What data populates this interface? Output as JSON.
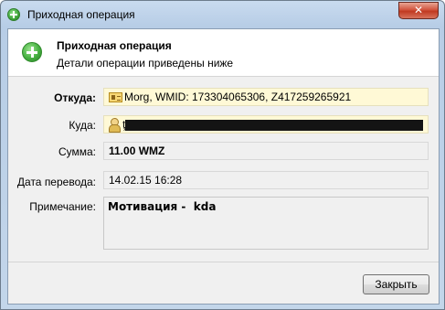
{
  "window": {
    "title": "Приходная операция",
    "close_glyph": "✕"
  },
  "header": {
    "title": "Приходная операция",
    "subtitle": "Детали операции приведены ниже"
  },
  "form": {
    "from_label": "Откуда:",
    "from_value": "Morg, WMID: 173304065306, Z417259265921",
    "to_label": "Куда:",
    "to_value_prefix": "ţ",
    "amount_label": "Сумма:",
    "amount_value": "11.00 WMZ",
    "date_label": "Дата перевода:",
    "date_value": "14.02.15 16:28",
    "note_label": "Примечание:",
    "note_value": "Мотивация -  kda"
  },
  "footer": {
    "close_label": "Закрыть"
  },
  "icons": {
    "title_icon": "plus-circle-icon",
    "header_icon": "plus-circle-icon",
    "from_icon": "id-card-icon",
    "to_icon": "person-icon"
  }
}
